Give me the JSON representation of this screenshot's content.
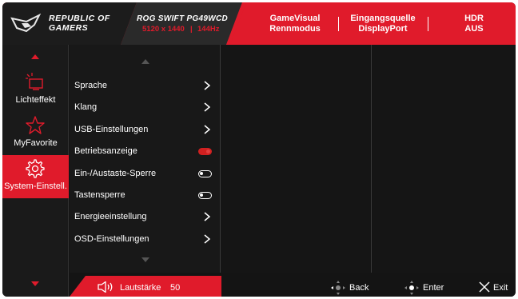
{
  "brand": {
    "line1": "REPUBLIC OF",
    "line2": "GAMERS"
  },
  "model": {
    "name": "ROG SWIFT PG49WCD",
    "resolution": "5120 x 1440",
    "refresh": "144Hz"
  },
  "status": {
    "gamevisual_label": "GameVisual",
    "gamevisual_value": "Rennmodus",
    "input_label": "Eingangsquelle",
    "input_value": "DisplayPort",
    "hdr_label": "HDR",
    "hdr_value": "AUS"
  },
  "sidebar": {
    "items": [
      {
        "label": "Lichteffekt",
        "icon": "light-effect-icon",
        "active": false
      },
      {
        "label": "MyFavorite",
        "icon": "star-icon",
        "active": false
      },
      {
        "label": "System-Einstell.",
        "icon": "gear-icon",
        "active": true
      }
    ]
  },
  "menu": {
    "items": [
      {
        "label": "Sprache",
        "control": "arrow"
      },
      {
        "label": "Klang",
        "control": "arrow"
      },
      {
        "label": "USB-Einstellungen",
        "control": "arrow"
      },
      {
        "label": "Betriebsanzeige",
        "control": "toggle-on"
      },
      {
        "label": "Ein-/Austaste-Sperre",
        "control": "toggle-off"
      },
      {
        "label": "Tastensperre",
        "control": "toggle-off"
      },
      {
        "label": "Energieeinstellung",
        "control": "arrow"
      },
      {
        "label": "OSD-Einstellungen",
        "control": "arrow"
      }
    ]
  },
  "footer": {
    "volume_label": "Lautstärke",
    "volume_value": "50",
    "back_label": "Back",
    "enter_label": "Enter",
    "exit_label": "Exit"
  },
  "colors": {
    "accent": "#e01b2b",
    "background": "#141414"
  }
}
